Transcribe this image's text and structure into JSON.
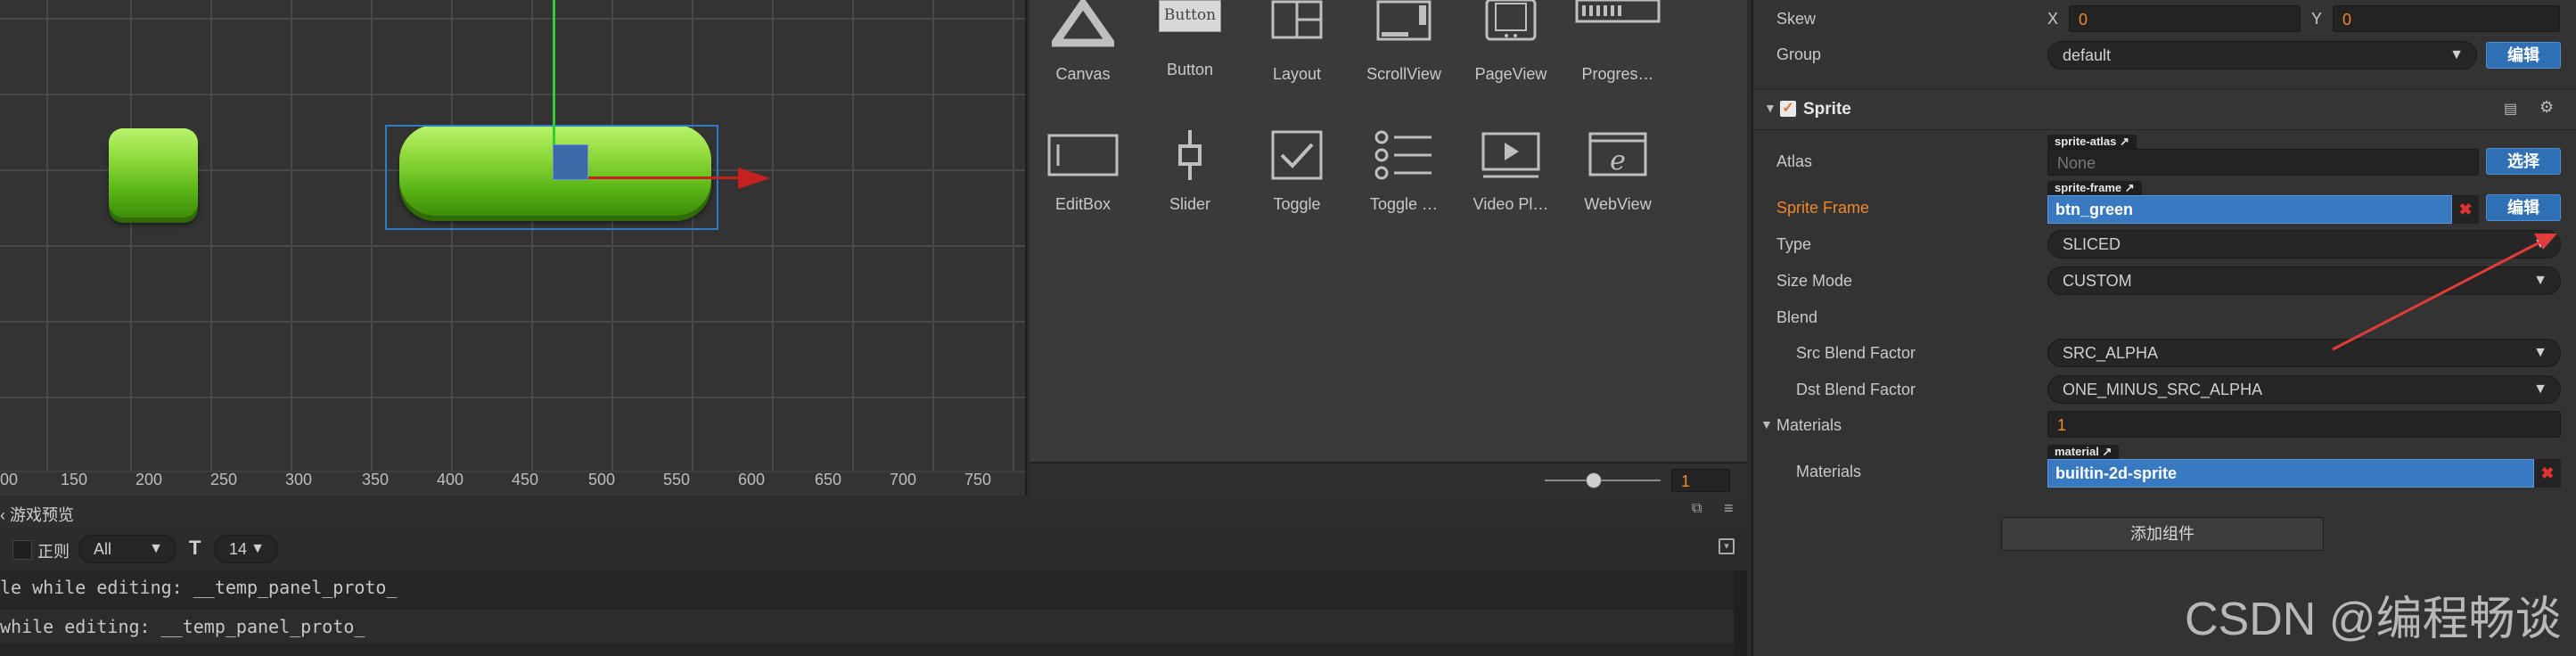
{
  "scene": {
    "ruler_labels": [
      "00",
      "150",
      "200",
      "250",
      "300",
      "350",
      "400",
      "450",
      "500",
      "550",
      "600",
      "650",
      "700",
      "750"
    ]
  },
  "widgets": {
    "row1": [
      {
        "label": "Canvas",
        "icon": "canvas-icon"
      },
      {
        "label": "Button",
        "icon": "button-icon",
        "icon_text": "Button"
      },
      {
        "label": "Layout",
        "icon": "layout-icon"
      },
      {
        "label": "ScrollView",
        "icon": "scrollview-icon"
      },
      {
        "label": "PageView",
        "icon": "pageview-icon"
      },
      {
        "label": "Progres…",
        "icon": "progressbar-icon"
      }
    ],
    "row2": [
      {
        "label": "EditBox",
        "icon": "editbox-icon"
      },
      {
        "label": "Slider",
        "icon": "slider-icon"
      },
      {
        "label": "Toggle",
        "icon": "toggle-icon"
      },
      {
        "label": "Toggle …",
        "icon": "toggle-group-icon"
      },
      {
        "label": "Video Pl…",
        "icon": "videoplayer-icon"
      },
      {
        "label": "WebView",
        "icon": "webview-icon"
      }
    ],
    "zoom_value": "1"
  },
  "console": {
    "tab_label": "游戏预览",
    "regex_label": "正则",
    "filter_value": "All",
    "font_size": "14",
    "lines": [
      "le while editing: __temp_panel_proto_",
      "while editing: __temp_panel_proto_"
    ]
  },
  "inspector": {
    "skew_label": "Skew",
    "skew_x_label": "X",
    "skew_x": "0",
    "skew_y_label": "Y",
    "skew_y": "0",
    "group_label": "Group",
    "group_value": "default",
    "edit_label": "编辑",
    "sprite_section": "Sprite",
    "atlas_label": "Atlas",
    "atlas_tag": "sprite-atlas",
    "atlas_value": "None",
    "select_label": "选择",
    "sprite_frame_label": "Sprite Frame",
    "sprite_frame_tag": "sprite-frame",
    "sprite_frame_value": "btn_green",
    "type_label": "Type",
    "type_value": "SLICED",
    "size_mode_label": "Size Mode",
    "size_mode_value": "CUSTOM",
    "blend_label": "Blend",
    "src_blend_label": "Src Blend Factor",
    "src_blend_value": "SRC_ALPHA",
    "dst_blend_label": "Dst Blend Factor",
    "dst_blend_value": "ONE_MINUS_SRC_ALPHA",
    "materials_section": "Materials",
    "materials_count": "1",
    "materials_label": "Materials",
    "material_tag": "material",
    "material_value": "builtin-2d-sprite",
    "add_component": "添加组件",
    "accent_orange": "#f0882c",
    "accent_blue": "#3879c2"
  },
  "watermark": "CSDN @编程畅谈"
}
